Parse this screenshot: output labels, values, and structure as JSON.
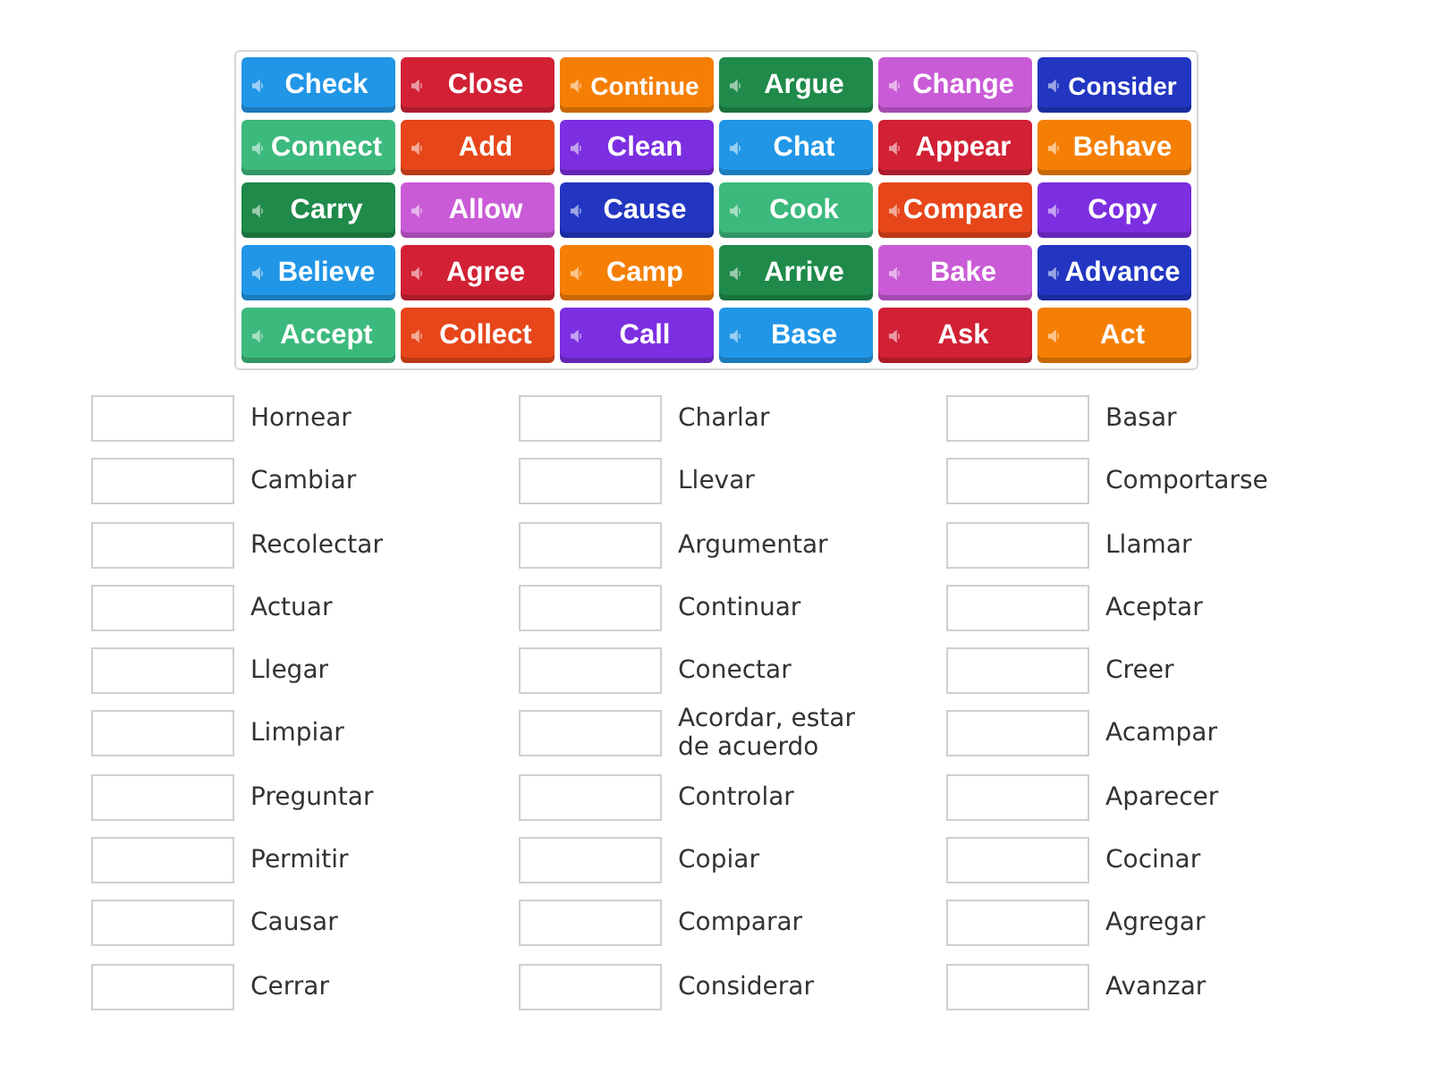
{
  "tiles": [
    {
      "label": "Check",
      "color": "#2196e6"
    },
    {
      "label": "Close",
      "color": "#d22135"
    },
    {
      "label": "Continue",
      "color": "#f57f05"
    },
    {
      "label": "Argue",
      "color": "#1f8a4a"
    },
    {
      "label": "Change",
      "color": "#c95bd6"
    },
    {
      "label": "Consider",
      "color": "#2236c2"
    },
    {
      "label": "Connect",
      "color": "#3cb97c"
    },
    {
      "label": "Add",
      "color": "#e6461a"
    },
    {
      "label": "Clean",
      "color": "#7c2fe0"
    },
    {
      "label": "Chat",
      "color": "#2196e6"
    },
    {
      "label": "Appear",
      "color": "#d22135"
    },
    {
      "label": "Behave",
      "color": "#f57f05"
    },
    {
      "label": "Carry",
      "color": "#1f8a4a"
    },
    {
      "label": "Allow",
      "color": "#c95bd6"
    },
    {
      "label": "Cause",
      "color": "#2236c2"
    },
    {
      "label": "Cook",
      "color": "#3cb97c"
    },
    {
      "label": "Compare",
      "color": "#e6461a"
    },
    {
      "label": "Copy",
      "color": "#7c2fe0"
    },
    {
      "label": "Believe",
      "color": "#2196e6"
    },
    {
      "label": "Agree",
      "color": "#d22135"
    },
    {
      "label": "Camp",
      "color": "#f57f05"
    },
    {
      "label": "Arrive",
      "color": "#1f8a4a"
    },
    {
      "label": "Bake",
      "color": "#c95bd6"
    },
    {
      "label": "Advance",
      "color": "#2236c2"
    },
    {
      "label": "Accept",
      "color": "#3cb97c"
    },
    {
      "label": "Collect",
      "color": "#e6461a"
    },
    {
      "label": "Call",
      "color": "#7c2fe0"
    },
    {
      "label": "Base",
      "color": "#2196e6"
    },
    {
      "label": "Ask",
      "color": "#d22135"
    },
    {
      "label": "Act",
      "color": "#f57f05"
    }
  ],
  "answer_columns": [
    {
      "rows": [
        {
          "label": "Hornear"
        },
        {
          "label": "Cambiar"
        },
        {
          "label": "Recolectar"
        },
        {
          "label": "Actuar"
        },
        {
          "label": "Llegar"
        },
        {
          "label": "Limpiar"
        },
        {
          "label": "Preguntar"
        },
        {
          "label": "Permitir"
        },
        {
          "label": "Causar"
        },
        {
          "label": "Cerrar"
        }
      ]
    },
    {
      "rows": [
        {
          "label": "Charlar"
        },
        {
          "label": "Llevar"
        },
        {
          "label": "Argumentar"
        },
        {
          "label": "Continuar"
        },
        {
          "label": "Conectar"
        },
        {
          "label": "Acordar, estar de acuerdo"
        },
        {
          "label": "Controlar"
        },
        {
          "label": "Copiar"
        },
        {
          "label": "Comparar"
        },
        {
          "label": "Considerar"
        }
      ]
    },
    {
      "rows": [
        {
          "label": "Basar"
        },
        {
          "label": "Comportarse"
        },
        {
          "label": "Llamar"
        },
        {
          "label": "Aceptar"
        },
        {
          "label": "Creer"
        },
        {
          "label": "Acampar"
        },
        {
          "label": "Aparecer"
        },
        {
          "label": "Cocinar"
        },
        {
          "label": "Agregar"
        },
        {
          "label": "Avanzar"
        }
      ]
    }
  ]
}
